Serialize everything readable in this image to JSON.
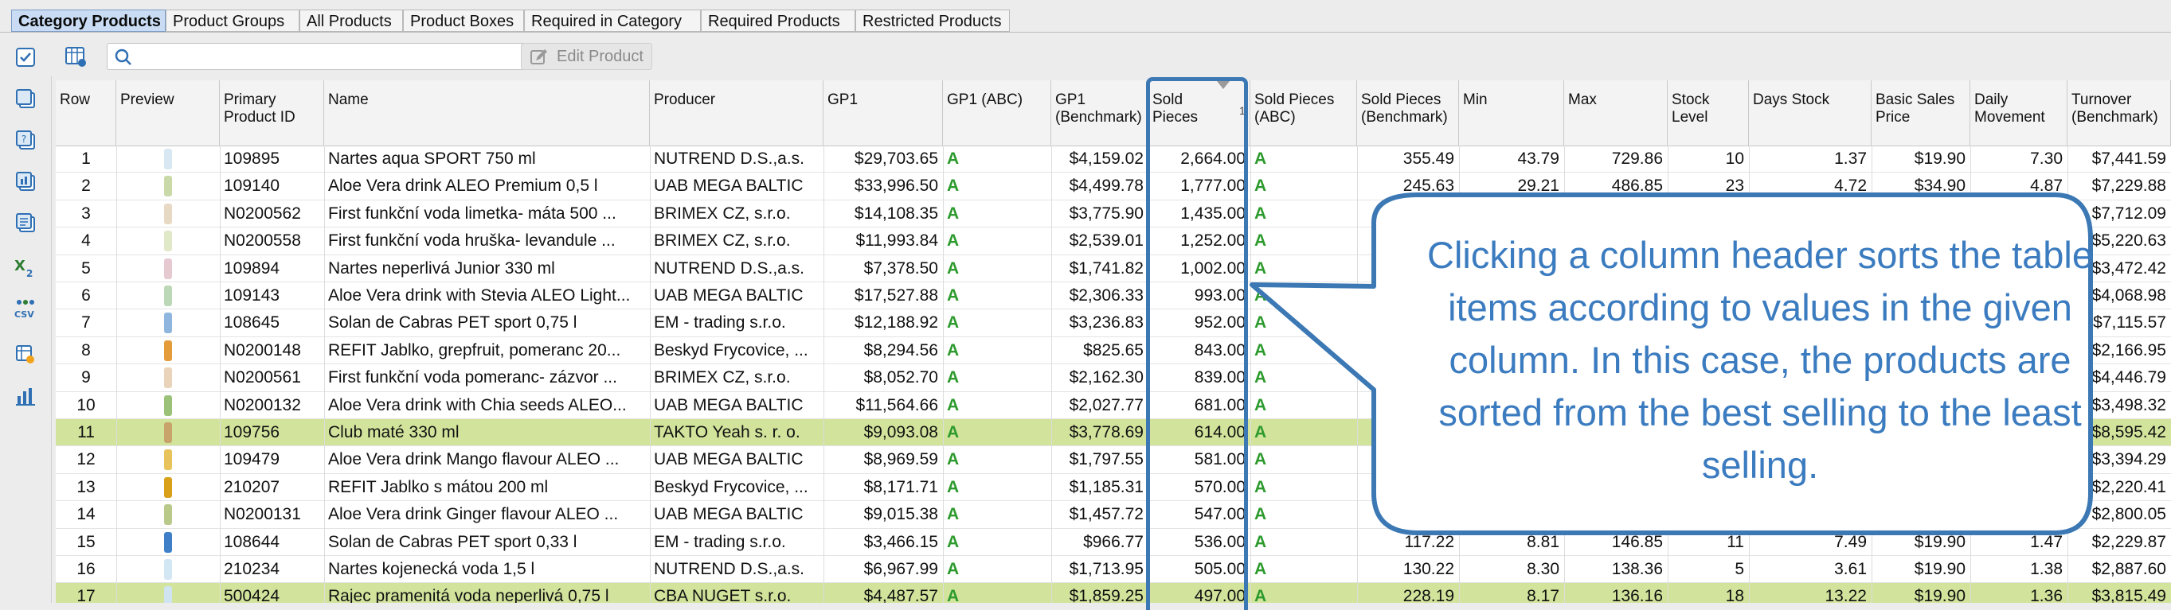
{
  "tabs": [
    {
      "label": "Category Products",
      "active": true
    },
    {
      "label": "Product Groups"
    },
    {
      "label": "All Products"
    },
    {
      "label": "Product Boxes"
    },
    {
      "label": "Required in Category"
    },
    {
      "label": "Required Products"
    },
    {
      "label": "Restricted Products"
    }
  ],
  "toolbar": {
    "search_placeholder": "",
    "edit_product_label": "Edit Product"
  },
  "left_toolbar_icons": [
    "checklist-icon",
    "copy-icon",
    "help-doc-icon",
    "chart-doc-icon",
    "pages-icon",
    "excel-export-icon",
    "csv-export-icon",
    "settings-table-icon",
    "bar-chart-icon"
  ],
  "table": {
    "columns": [
      "Row",
      "Preview",
      "Primary\nProduct ID",
      "Name",
      "Producer",
      "GP1",
      "GP1 (ABC)",
      "GP1\n(Benchmark)",
      "Sold\nPieces",
      "Sold Pieces\n(ABC)",
      "Sold Pieces\n(Benchmark)",
      "Min",
      "Max",
      "Stock Level",
      "Days Stock",
      "Basic Sales\nPrice",
      "Daily\nMovement",
      "Turnover\n(Benchmark)"
    ],
    "sort_indicator": "1",
    "rows": [
      {
        "row": "1",
        "id": "109895",
        "name": "Nartes aqua SPORT 750 ml",
        "producer": "NUTREND D.S.,a.s.",
        "gp1": "$29,703.65",
        "gp1abc": "A",
        "gp1b": "$4,159.02",
        "sold": "2,664.00",
        "soldabc": "A",
        "soldb": "355.49",
        "min": "43.79",
        "max": "729.86",
        "stock": "10",
        "days": "1.37",
        "price": "$19.90",
        "daily": "7.30",
        "turnover": "$7,441.59",
        "hl": false,
        "color": "#d7e8f2"
      },
      {
        "row": "2",
        "id": "109140",
        "name": "Aloe Vera drink ALEO Premium 0,5 l",
        "producer": "UAB MEGA BALTIC",
        "gp1": "$33,996.50",
        "gp1abc": "A",
        "gp1b": "$4,499.78",
        "sold": "1,777.00",
        "soldabc": "A",
        "soldb": "245.63",
        "min": "29.21",
        "max": "486.85",
        "stock": "23",
        "days": "4.72",
        "price": "$34.90",
        "daily": "4.87",
        "turnover": "$7,229.88",
        "hl": false,
        "color": "#c9d9a8"
      },
      {
        "row": "3",
        "id": "N0200562",
        "name": "First funkční voda limetka- máta 500 ...",
        "producer": "BRIMEX CZ, s.r.o.",
        "gp1": "$14,108.35",
        "gp1abc": "A",
        "gp1b": "$3,775.90",
        "sold": "1,435.00",
        "soldabc": "A",
        "soldb": "",
        "min": "",
        "max": "",
        "stock": "",
        "days": "",
        "price": "",
        "daily": "",
        "turnover": "$7,712.09",
        "hl": false,
        "color": "#e8d9c4"
      },
      {
        "row": "4",
        "id": "N0200558",
        "name": "First funkční voda hruška- levandule ...",
        "producer": "BRIMEX CZ, s.r.o.",
        "gp1": "$11,993.84",
        "gp1abc": "A",
        "gp1b": "$2,539.01",
        "sold": "1,252.00",
        "soldabc": "A",
        "soldb": "",
        "min": "",
        "max": "",
        "stock": "",
        "days": "",
        "price": "",
        "daily": "",
        "turnover": "$5,220.63",
        "hl": false,
        "color": "#e1e8c8"
      },
      {
        "row": "5",
        "id": "109894",
        "name": "Nartes neperlivá Junior 330 ml",
        "producer": "NUTREND D.S.,a.s.",
        "gp1": "$7,378.50",
        "gp1abc": "A",
        "gp1b": "$1,741.82",
        "sold": "1,002.00",
        "soldabc": "A",
        "soldb": "",
        "min": "",
        "max": "",
        "stock": "",
        "days": "",
        "price": "",
        "daily": "",
        "turnover": "$3,472.42",
        "hl": false,
        "color": "#e7c9d2"
      },
      {
        "row": "6",
        "id": "109143",
        "name": "Aloe Vera drink with Stevia ALEO Light...",
        "producer": "UAB MEGA BALTIC",
        "gp1": "$17,527.88",
        "gp1abc": "A",
        "gp1b": "$2,306.33",
        "sold": "993.00",
        "soldabc": "A",
        "soldb": "",
        "min": "",
        "max": "",
        "stock": "",
        "days": "",
        "price": "",
        "daily": "",
        "turnover": "$4,068.98",
        "hl": false,
        "color": "#bcd8b6"
      },
      {
        "row": "7",
        "id": "108645",
        "name": "Solan de Cabras PET sport 0,75 l",
        "producer": "EM - trading s.r.o.",
        "gp1": "$12,188.92",
        "gp1abc": "A",
        "gp1b": "$3,236.83",
        "sold": "952.00",
        "soldabc": "A",
        "soldb": "",
        "min": "",
        "max": "",
        "stock": "",
        "days": "",
        "price": "",
        "daily": "",
        "turnover": "$7,115.57",
        "hl": false,
        "color": "#8fb6df"
      },
      {
        "row": "8",
        "id": "N0200148",
        "name": "REFIT Jablko, grepfruit, pomeranc 20...",
        "producer": "Beskyd Frycovice, ...",
        "gp1": "$8,294.56",
        "gp1abc": "A",
        "gp1b": "$825.65",
        "sold": "843.00",
        "soldabc": "A",
        "soldb": "",
        "min": "",
        "max": "",
        "stock": "",
        "days": "",
        "price": "",
        "daily": "",
        "turnover": "$2,166.95",
        "hl": false,
        "color": "#e49b3a"
      },
      {
        "row": "9",
        "id": "N0200561",
        "name": "First funkční voda pomeranc- zázvor ...",
        "producer": "BRIMEX CZ, s.r.o.",
        "gp1": "$8,052.70",
        "gp1abc": "A",
        "gp1b": "$2,162.30",
        "sold": "839.00",
        "soldabc": "A",
        "soldb": "",
        "min": "",
        "max": "",
        "stock": "",
        "days": "",
        "price": "",
        "daily": "",
        "turnover": "$4,446.79",
        "hl": false,
        "color": "#ead3b8"
      },
      {
        "row": "10",
        "id": "N0200132",
        "name": "Aloe Vera drink with Chia seeds ALEO...",
        "producer": "UAB MEGA BALTIC",
        "gp1": "$11,564.66",
        "gp1abc": "A",
        "gp1b": "$2,027.77",
        "sold": "681.00",
        "soldabc": "A",
        "soldb": "",
        "min": "",
        "max": "",
        "stock": "",
        "days": "",
        "price": "",
        "daily": "",
        "turnover": "$3,498.32",
        "hl": false,
        "color": "#9cc27a"
      },
      {
        "row": "11",
        "id": "109756",
        "name": "Club maté 330 ml",
        "producer": "TAKTO Yeah s. r. o.",
        "gp1": "$9,093.08",
        "gp1abc": "A",
        "gp1b": "$3,778.69",
        "sold": "614.00",
        "soldabc": "A",
        "soldb": "",
        "min": "",
        "max": "",
        "stock": "",
        "days": "",
        "price": "",
        "daily": "",
        "turnover": "$8,595.42",
        "hl": true,
        "color": "#c9a46a"
      },
      {
        "row": "12",
        "id": "109479",
        "name": "Aloe Vera drink Mango flavour ALEO ...",
        "producer": "UAB MEGA BALTIC",
        "gp1": "$8,969.59",
        "gp1abc": "A",
        "gp1b": "$1,797.55",
        "sold": "581.00",
        "soldabc": "A",
        "soldb": "",
        "min": "",
        "max": "",
        "stock": "",
        "days": "",
        "price": "",
        "daily": "",
        "turnover": "$3,394.29",
        "hl": false,
        "color": "#e8c25a"
      },
      {
        "row": "13",
        "id": "210207",
        "name": "REFIT Jablko s mátou 200 ml",
        "producer": "Beskyd Frycovice, ...",
        "gp1": "$8,171.71",
        "gp1abc": "A",
        "gp1b": "$1,185.31",
        "sold": "570.00",
        "soldabc": "A",
        "soldb": "",
        "min": "",
        "max": "",
        "stock": "",
        "days": "",
        "price": "",
        "daily": "",
        "turnover": "$2,220.41",
        "hl": false,
        "color": "#d9a01a"
      },
      {
        "row": "14",
        "id": "N0200131",
        "name": "Aloe Vera drink Ginger flavour ALEO ...",
        "producer": "UAB MEGA BALTIC",
        "gp1": "$9,015.38",
        "gp1abc": "A",
        "gp1b": "$1,457.72",
        "sold": "547.00",
        "soldabc": "A",
        "soldb": "",
        "min": "",
        "max": "",
        "stock": "",
        "days": "",
        "price": "",
        "daily": "",
        "turnover": "$2,800.05",
        "hl": false,
        "color": "#b9c98a"
      },
      {
        "row": "15",
        "id": "108644",
        "name": "Solan de Cabras PET sport 0,33 l",
        "producer": "EM - trading s.r.o.",
        "gp1": "$3,466.15",
        "gp1abc": "A",
        "gp1b": "$966.77",
        "sold": "536.00",
        "soldabc": "A",
        "soldb": "117.22",
        "min": "8.81",
        "max": "146.85",
        "stock": "11",
        "days": "7.49",
        "price": "$19.90",
        "daily": "1.47",
        "turnover": "$2,229.87",
        "hl": false,
        "color": "#3e7fc7"
      },
      {
        "row": "16",
        "id": "210234",
        "name": "Nartes kojenecká voda 1,5 l",
        "producer": "NUTREND D.S.,a.s.",
        "gp1": "$6,967.99",
        "gp1abc": "A",
        "gp1b": "$1,713.95",
        "sold": "505.00",
        "soldabc": "A",
        "soldb": "130.22",
        "min": "8.30",
        "max": "138.36",
        "stock": "5",
        "days": "3.61",
        "price": "$19.90",
        "daily": "1.38",
        "turnover": "$2,887.60",
        "hl": false,
        "color": "#d3e6f3"
      },
      {
        "row": "17",
        "id": "500424",
        "name": "Rajec pramenitá voda neperlivá 0,75 l",
        "producer": "CBA NUGET s.r.o.",
        "gp1": "$4,487.57",
        "gp1abc": "A",
        "gp1b": "$1,859.25",
        "sold": "497.00",
        "soldabc": "A",
        "soldb": "228.19",
        "min": "8.17",
        "max": "136.16",
        "stock": "18",
        "days": "13.22",
        "price": "$19.90",
        "daily": "1.36",
        "turnover": "$3,815.49",
        "hl": true,
        "color": "#cfe3f0"
      }
    ]
  },
  "callout": {
    "text": "Clicking a column header sorts the table items according to values in the given column. In this case, the products are sorted from the best selling to the least selling."
  },
  "colors": {
    "accent": "#3b78b4",
    "highlight_row": "#d2e49c",
    "abc_green": "#2c9a2c",
    "callout_text": "#3b7bbf"
  }
}
